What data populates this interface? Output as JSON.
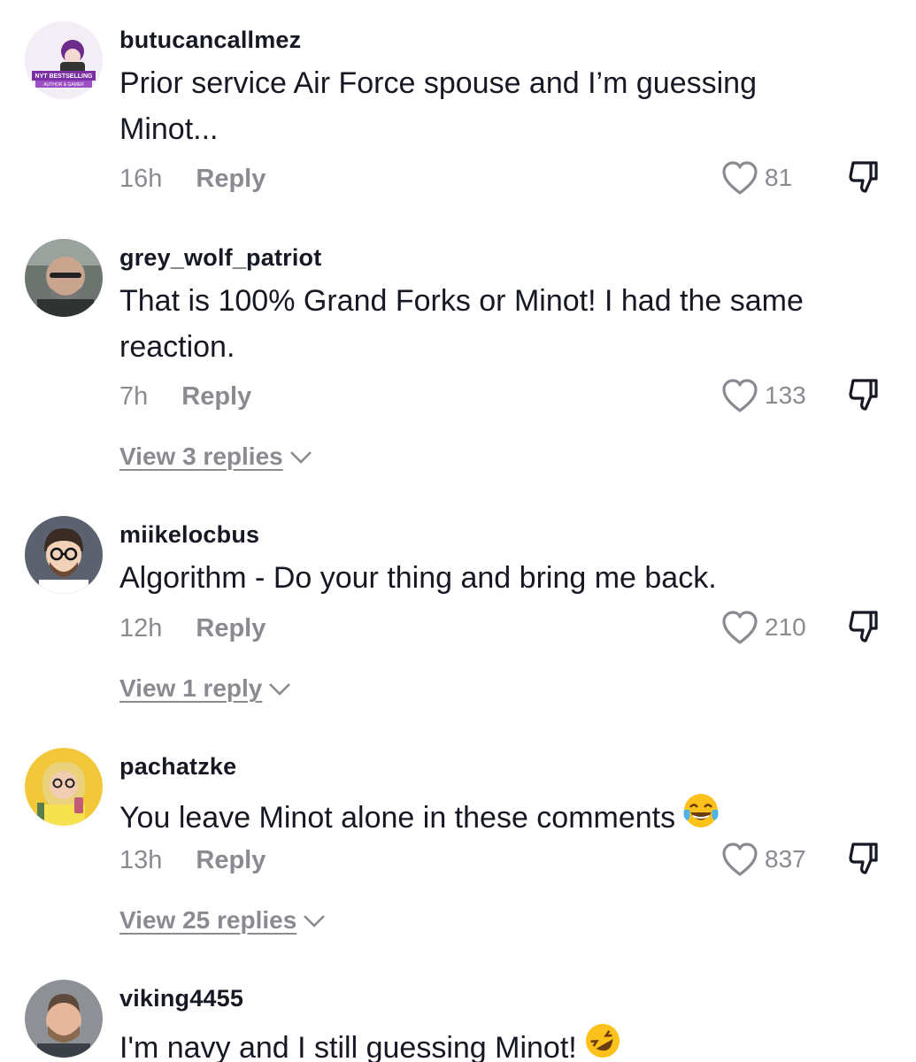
{
  "comments": [
    {
      "username": "butucancallmez",
      "text": "Prior service Air Force spouse and I’m guessing Minot...",
      "time": "16h",
      "reply_label": "Reply",
      "likes": "81",
      "avatar_text_line1": "NYT BESTSELLING",
      "avatar_text_line2": "AUTHOR & GAMER"
    },
    {
      "username": "grey_wolf_patriot",
      "text": "That is 100% Grand Forks or Minot! I had the same reaction.",
      "time": "7h",
      "reply_label": "Reply",
      "likes": "133",
      "view_replies": "View 3 replies"
    },
    {
      "username": "miikelocbus",
      "text": "Algorithm - Do your thing and bring me back.",
      "time": "12h",
      "reply_label": "Reply",
      "likes": "210",
      "view_replies": "View 1 reply"
    },
    {
      "username": "pachatzke",
      "text": "You leave Minot alone in these comments",
      "time": "13h",
      "reply_label": "Reply",
      "likes": "837",
      "view_replies": "View 25 replies",
      "emoji": "tears-of-joy-emoji"
    },
    {
      "username": "viking4455",
      "text": "I'm navy and I still guessing Minot!",
      "emoji": "rolling-on-floor-laughing-emoji"
    }
  ],
  "colors": {
    "text": "#161823",
    "muted": "#8a8b91",
    "background": "#ffffff"
  }
}
